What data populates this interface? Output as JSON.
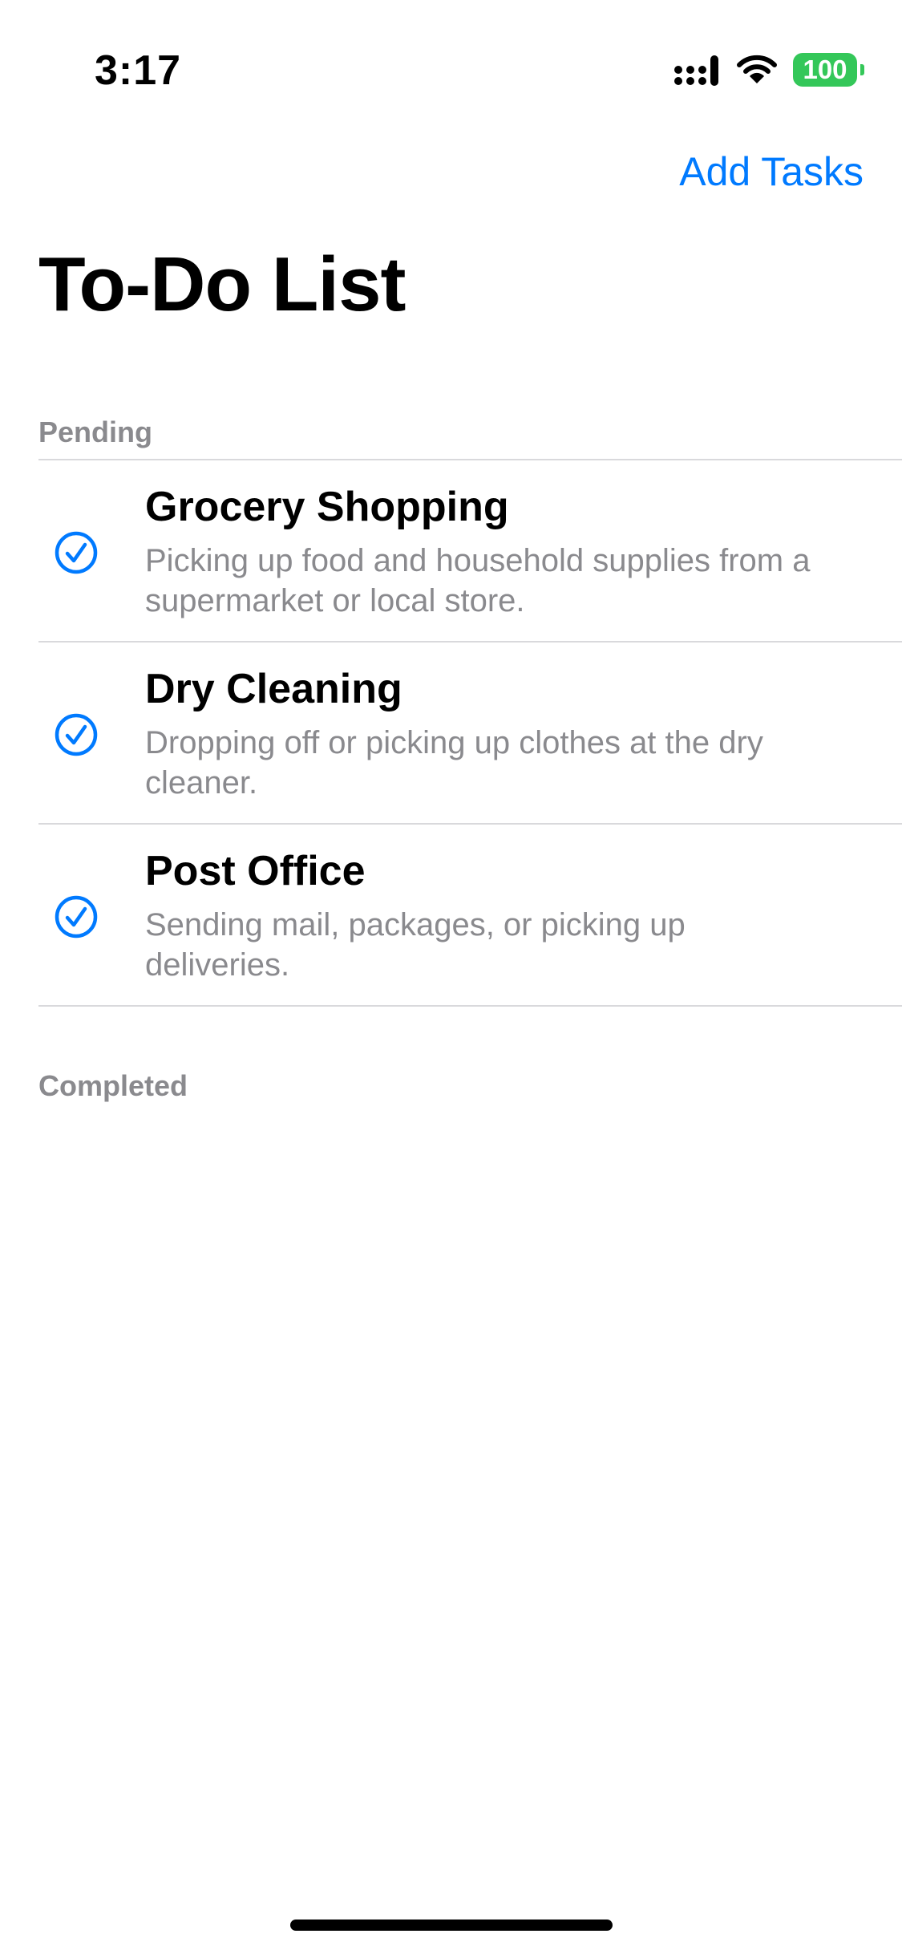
{
  "status_bar": {
    "time": "3:17",
    "signal_icon": "cellular-signal-icon",
    "wifi_icon": "wifi-icon",
    "battery": "100",
    "battery_color": "#34c759"
  },
  "nav": {
    "action_label": "Add Tasks",
    "accent_color": "#007aff"
  },
  "page": {
    "title": "To-Do List"
  },
  "sections": {
    "pending": {
      "header": "Pending",
      "tasks": [
        {
          "title": "Grocery Shopping",
          "description": "Picking up food and household supplies from a supermarket or local store.",
          "icon": "checkmark-circle-icon"
        },
        {
          "title": "Dry Cleaning",
          "description": "Dropping off or picking up clothes at the dry cleaner.",
          "icon": "checkmark-circle-icon"
        },
        {
          "title": "Post Office",
          "description": "Sending mail, packages, or picking up deliveries.",
          "icon": "checkmark-circle-icon"
        }
      ]
    },
    "completed": {
      "header": "Completed"
    }
  }
}
